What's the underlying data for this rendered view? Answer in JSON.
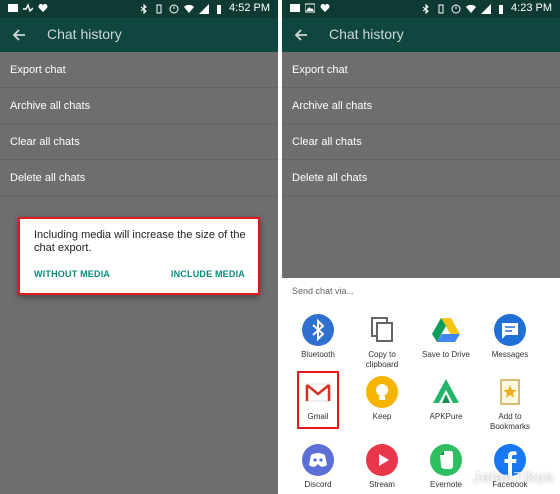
{
  "left": {
    "status": {
      "time": "4:52 PM"
    },
    "appbar": {
      "title": "Chat history"
    },
    "menu": [
      "Export chat",
      "Archive all chats",
      "Clear all chats",
      "Delete all chats"
    ],
    "dialog": {
      "message": "Including media will increase the size of the chat export.",
      "without_media": "WITHOUT MEDIA",
      "include_media": "INCLUDE MEDIA"
    }
  },
  "right": {
    "status": {
      "time": "4:23 PM"
    },
    "appbar": {
      "title": "Chat history"
    },
    "menu": [
      "Export chat",
      "Archive all chats",
      "Clear all chats",
      "Delete all chats"
    ],
    "sheet": {
      "title": "Send chat via...",
      "apps": [
        {
          "label": "Bluetooth",
          "icon": "bluetooth-icon"
        },
        {
          "label": "Copy to clipboard",
          "icon": "copy-icon"
        },
        {
          "label": "Save to Drive",
          "icon": "drive-icon"
        },
        {
          "label": "Messages",
          "icon": "messages-icon"
        },
        {
          "label": "Gmail",
          "icon": "gmail-icon"
        },
        {
          "label": "Keep",
          "icon": "keep-icon"
        },
        {
          "label": "APKPure",
          "icon": "apkpure-icon"
        },
        {
          "label": "Add to Bookmarks",
          "icon": "bookmarks-icon"
        },
        {
          "label": "Discord",
          "icon": "discord-icon"
        },
        {
          "label": "Stream",
          "icon": "stream-icon"
        },
        {
          "label": "Evernote",
          "icon": "evernote-icon"
        },
        {
          "label": "Facebook",
          "icon": "facebook-icon"
        }
      ]
    }
  },
  "watermark": "JalanTikus",
  "colors": {
    "appbar": "#0f463f",
    "statusbar": "#0e3a33",
    "accent": "#0b8a7c",
    "highlight": "#e0171b",
    "scrim": "#6e6e6e"
  }
}
